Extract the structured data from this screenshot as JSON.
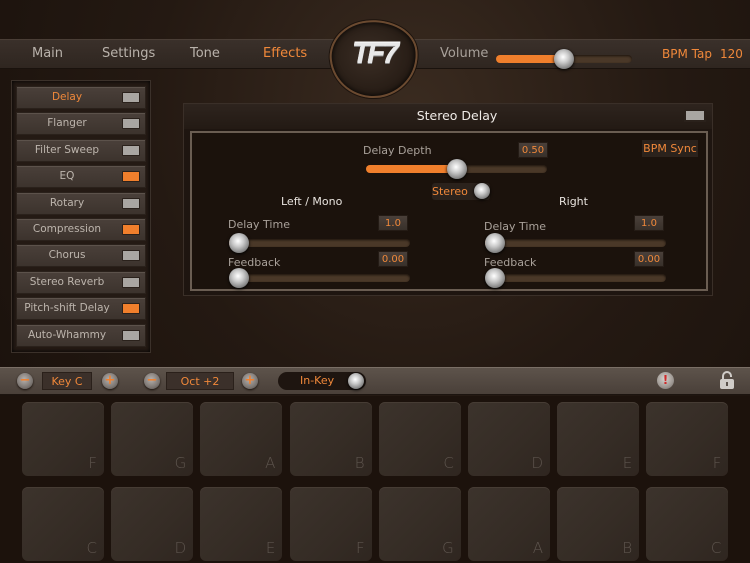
{
  "nav": {
    "tabs": [
      {
        "label": "Main",
        "active": false
      },
      {
        "label": "Settings",
        "active": false
      },
      {
        "label": "Tone",
        "active": false
      },
      {
        "label": "Effects",
        "active": true
      }
    ],
    "logo_text": "TF7",
    "volume_label": "Volume",
    "volume_value": 0.5,
    "bpm_tap_label": "BPM Tap",
    "bpm_value": "120"
  },
  "sidebar": {
    "items": [
      {
        "label": "Delay",
        "active": true,
        "enabled": false
      },
      {
        "label": "Flanger",
        "active": false,
        "enabled": false
      },
      {
        "label": "Filter Sweep",
        "active": false,
        "enabled": false
      },
      {
        "label": "EQ",
        "active": false,
        "enabled": true
      },
      {
        "label": "Rotary",
        "active": false,
        "enabled": false
      },
      {
        "label": "Compression",
        "active": false,
        "enabled": true
      },
      {
        "label": "Chorus",
        "active": false,
        "enabled": false
      },
      {
        "label": "Stereo Reverb",
        "active": false,
        "enabled": false
      },
      {
        "label": "Pitch-shift Delay",
        "active": false,
        "enabled": true
      },
      {
        "label": "Auto-Whammy",
        "active": false,
        "enabled": false
      }
    ]
  },
  "panel": {
    "title": "Stereo Delay",
    "enabled": false,
    "bpm_sync_label": "BPM Sync",
    "delay_depth": {
      "label": "Delay Depth",
      "value": "0.50",
      "fraction": 0.5
    },
    "stereo_label": "Stereo",
    "left": {
      "heading": "Left / Mono",
      "delay_time": {
        "label": "Delay Time",
        "value": "1.0",
        "fraction": 0.0
      },
      "feedback": {
        "label": "Feedback",
        "value": "0.00",
        "fraction": 0.0
      }
    },
    "right": {
      "heading": "Right",
      "delay_time": {
        "label": "Delay Time",
        "value": "1.0",
        "fraction": 0.0
      },
      "feedback": {
        "label": "Feedback",
        "value": "0.00",
        "fraction": 0.0
      }
    }
  },
  "keybar": {
    "key_label": "Key C",
    "octave_label": "Oct +2",
    "inkey_label": "In-Key",
    "minus_glyph": "−",
    "plus_glyph": "+",
    "alert_glyph": "!"
  },
  "pads": {
    "row1": [
      "F",
      "G",
      "A",
      "B",
      "C",
      "D",
      "E",
      "F"
    ],
    "row2": [
      "C",
      "D",
      "E",
      "F",
      "G",
      "A",
      "B",
      "C"
    ]
  },
  "colors": {
    "accent": "#f0883a",
    "led_on": "#f07f2c",
    "led_off": "#a9a6a2"
  }
}
